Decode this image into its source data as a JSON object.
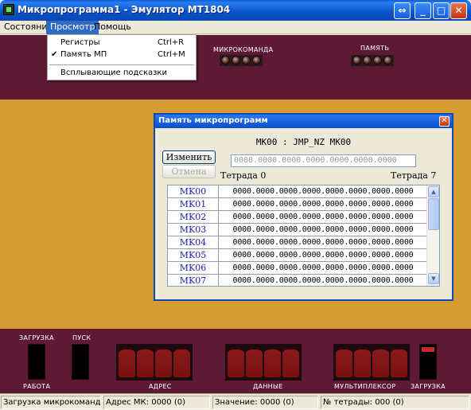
{
  "window": {
    "title": "Микропрограмма1 - Эмулятор МТ1804",
    "buttons": {
      "restore": "⇔",
      "minimize": "_",
      "maximize": "□",
      "close": "✕"
    }
  },
  "menu": {
    "items": [
      "Состояние",
      "Просмотр",
      "Помощь"
    ],
    "active": "Просмотр",
    "dropdown": [
      {
        "label": "Регистры",
        "shortcut": "Ctrl+R",
        "checked": ""
      },
      {
        "label": "Память МП",
        "shortcut": "Ctrl+M",
        "checked": "✔"
      },
      {
        "label": "Всплывающие подсказки",
        "shortcut": "",
        "checked": ""
      }
    ]
  },
  "top_panel": {
    "microcommand_label": "МИКРОКОМАНДА",
    "memory_label": "ПАМЯТЬ"
  },
  "bottom_panel": {
    "load_label": "ЗАГРУЗКА",
    "start_label": "ПУСК",
    "work_label": "РАБОТА",
    "address_label": "АДРЕС",
    "data_label": "ДАННЫЕ",
    "mux_label": "МУЛЬТИПЛЕКСОР",
    "load2_label": "ЗАГРУЗКА"
  },
  "mp_window": {
    "title": "Память микропрограмм",
    "close": "✕",
    "command": "MK00 : JMP_NZ MK00",
    "change_button": "Изменить",
    "cancel_button": "Отмена",
    "edit_value": "0000.0000.0000.0000.0000.0000.0000",
    "tetrad_left": "Тетрада 0",
    "tetrad_right": "Тетрада 7",
    "rows": [
      {
        "addr": "MK00",
        "value": "0000.0000.0000.0000.0000.0000.0000.0000"
      },
      {
        "addr": "MK01",
        "value": "0000.0000.0000.0000.0000.0000.0000.0000"
      },
      {
        "addr": "MK02",
        "value": "0000.0000.0000.0000.0000.0000.0000.0000"
      },
      {
        "addr": "MK03",
        "value": "0000.0000.0000.0000.0000.0000.0000.0000"
      },
      {
        "addr": "MK04",
        "value": "0000.0000.0000.0000.0000.0000.0000.0000"
      },
      {
        "addr": "MK05",
        "value": "0000.0000.0000.0000.0000.0000.0000.0000"
      },
      {
        "addr": "MK06",
        "value": "0000.0000.0000.0000.0000.0000.0000.0000"
      },
      {
        "addr": "MK07",
        "value": "0000.0000.0000.0000.0000.0000.0000.0000"
      }
    ],
    "scroll_up": "▲",
    "scroll_down": "▼"
  },
  "statusbar": {
    "status": "Загрузка микрокоманд",
    "address": "Адрес МК: 0000 (0)",
    "value": "Значение: 0000 (0)",
    "tetrad": "№ тетрады: 000 (0)"
  },
  "colors": {
    "panel_dark": "#5e1a35",
    "panel_mid": "#d49a33",
    "segment_red": "#7a0f0f",
    "title_blue": "#0852c8"
  }
}
